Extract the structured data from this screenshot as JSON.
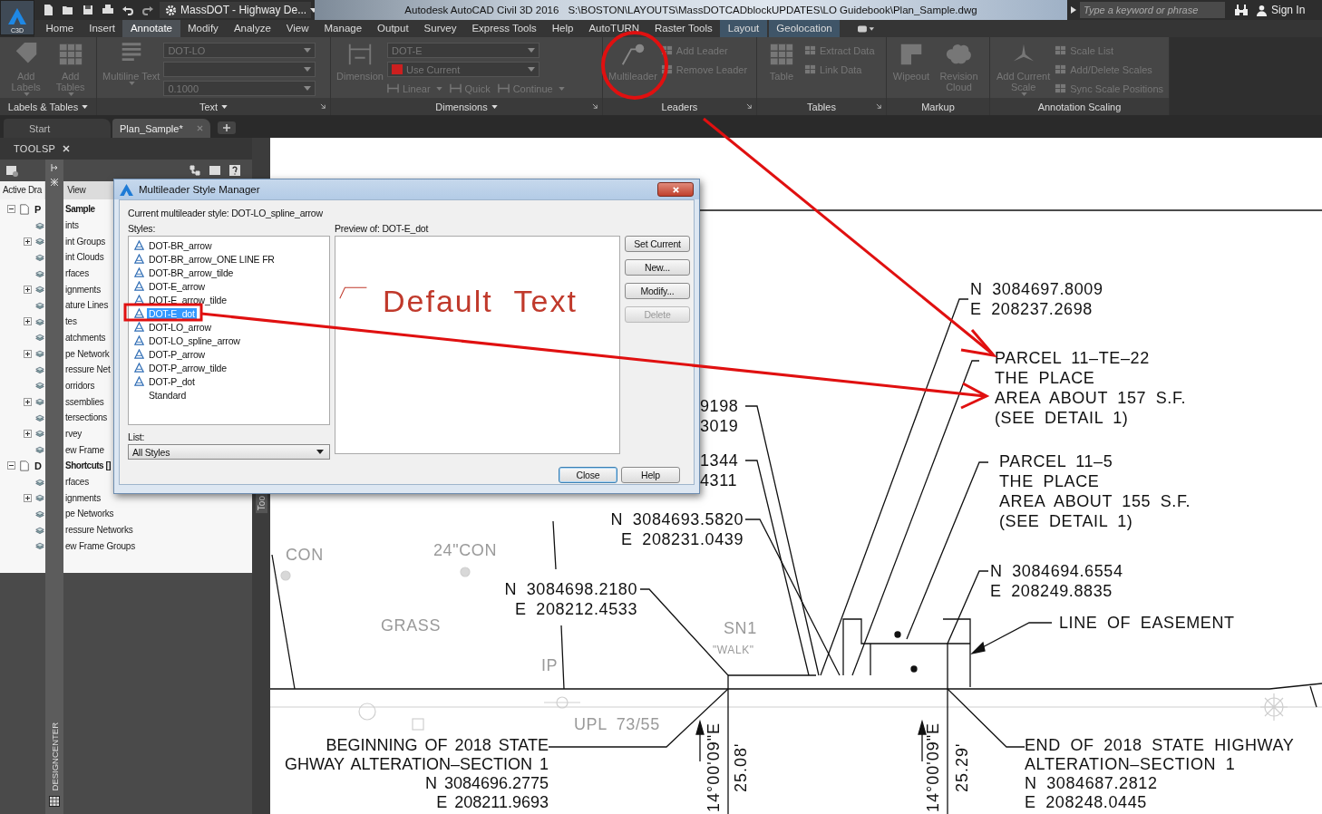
{
  "title_bar": {
    "app_label": "C3D",
    "workspace": "MassDOT - Highway De...",
    "title": "Autodesk AutoCAD Civil 3D 2016",
    "file_path": "S:\\BOSTON\\LAYOUTS\\MassDOTCADblockUPDATES\\LO Guidebook\\Plan_Sample.dwg",
    "search": {
      "placeholder": "Type a keyword or phrase"
    },
    "sign_in": "Sign In"
  },
  "ribbon_tabs": [
    {
      "label": "Home",
      "selected": false,
      "contextual": false
    },
    {
      "label": "Insert",
      "selected": false,
      "contextual": false
    },
    {
      "label": "Annotate",
      "selected": true,
      "contextual": false
    },
    {
      "label": "Modify",
      "selected": false,
      "contextual": false
    },
    {
      "label": "Analyze",
      "selected": false,
      "contextual": false
    },
    {
      "label": "View",
      "selected": false,
      "contextual": false
    },
    {
      "label": "Manage",
      "selected": false,
      "contextual": false
    },
    {
      "label": "Output",
      "selected": false,
      "contextual": false
    },
    {
      "label": "Survey",
      "selected": false,
      "contextual": false
    },
    {
      "label": "Express Tools",
      "selected": false,
      "contextual": false
    },
    {
      "label": "Help",
      "selected": false,
      "contextual": false
    },
    {
      "label": "AutoTURN",
      "selected": false,
      "contextual": false
    },
    {
      "label": "Raster Tools",
      "selected": false,
      "contextual": false
    },
    {
      "label": "Layout",
      "selected": false,
      "contextual": true
    },
    {
      "label": "Geolocation",
      "selected": false,
      "contextual": true
    }
  ],
  "ribbon_panels": [
    {
      "title": "Labels & Tables",
      "menu": true,
      "launcher": false,
      "items": [
        {
          "kind": "large",
          "label": "Add Labels",
          "menu": true,
          "disabled": true
        },
        {
          "kind": "large",
          "label": "Add Tables",
          "menu": true,
          "disabled": true
        }
      ]
    },
    {
      "title": "Text",
      "menu": true,
      "launcher": true,
      "items": [
        {
          "kind": "large",
          "label": "Multiline Text",
          "menu": true,
          "disabled": true
        },
        {
          "kind": "combo",
          "value": "DOT-LO",
          "disabled": true
        },
        {
          "kind": "combo",
          "disabled": true
        },
        {
          "kind": "combo",
          "value": "0.1000",
          "disabled": true
        }
      ]
    },
    {
      "title": "Dimensions",
      "menu": true,
      "launcher": true,
      "items": [
        {
          "kind": "large",
          "label": "Dimension",
          "disabled": true
        },
        {
          "kind": "combo",
          "value": "DOT-E",
          "disabled": true
        },
        {
          "kind": "combo",
          "value": "Use Current",
          "color": "#cc1f1f",
          "disabled": true
        },
        {
          "kind": "row",
          "buttons": [
            {
              "label": "Linear",
              "menu": true,
              "disabled": true
            },
            {
              "label": "Quick",
              "disabled": true
            },
            {
              "label": "Continue",
              "menu": true,
              "disabled": true
            }
          ]
        }
      ]
    },
    {
      "title": "Leaders",
      "menu": false,
      "launcher": true,
      "items": [
        {
          "kind": "large",
          "label": "Multileader",
          "disabled": true
        },
        {
          "kind": "small",
          "label": "Add Leader",
          "disabled": true
        },
        {
          "kind": "small",
          "label": "Remove Leader",
          "disabled": true
        }
      ]
    },
    {
      "title": "Tables",
      "menu": false,
      "launcher": true,
      "items": [
        {
          "kind": "large",
          "label": "Table",
          "disabled": true
        },
        {
          "kind": "small",
          "label": "Extract Data",
          "disabled": true
        },
        {
          "kind": "small",
          "label": "Link Data",
          "disabled": true
        }
      ]
    },
    {
      "title": "Markup",
      "menu": false,
      "launcher": false,
      "items": [
        {
          "kind": "large",
          "label": "Wipeout",
          "disabled": true
        },
        {
          "kind": "large",
          "label": "Revision Cloud",
          "disabled": true
        }
      ]
    },
    {
      "title": "Annotation Scaling",
      "menu": false,
      "launcher": false,
      "items": [
        {
          "kind": "large",
          "label": "Add Current Scale",
          "menu": true,
          "disabled": true
        },
        {
          "kind": "small",
          "label": "Scale List",
          "disabled": true
        },
        {
          "kind": "small",
          "label": "Add/Delete Scales",
          "disabled": true
        },
        {
          "kind": "small",
          "label": "Sync Scale Positions",
          "disabled": true
        }
      ]
    }
  ],
  "file_tabs": [
    {
      "label": "Start",
      "selected": false
    },
    {
      "label": "Plan_Sample*",
      "selected": true
    }
  ],
  "toolspace": {
    "title": "TOOLSP",
    "tabs": [
      {
        "label": "Active Dra",
        "selected": true
      },
      {
        "label": "View",
        "selected": false
      }
    ],
    "tree": [
      {
        "prefix": "P",
        "label": "Sample",
        "expanded": true,
        "children": [
          {
            "label": "ints"
          },
          {
            "label": "int Groups",
            "expanded": false
          },
          {
            "label": "int Clouds"
          },
          {
            "label": "rfaces"
          },
          {
            "label": "ignments",
            "expanded": false
          },
          {
            "label": "ature Lines"
          },
          {
            "label": "tes",
            "expanded": false
          },
          {
            "label": "atchments"
          },
          {
            "label": "pe Network",
            "expanded": false
          },
          {
            "label": "ressure Net"
          },
          {
            "label": "orridors"
          },
          {
            "label": "ssemblies",
            "expanded": false
          },
          {
            "label": "tersections"
          },
          {
            "label": "rvey",
            "expanded": false
          },
          {
            "label": "ew Frame"
          }
        ]
      },
      {
        "prefix": "D",
        "label": "Shortcuts []",
        "expanded": true,
        "children": [
          {
            "label": "rfaces"
          },
          {
            "label": "ignments",
            "expanded": false
          },
          {
            "label": "pe Networks"
          },
          {
            "label": "ressure Networks"
          },
          {
            "label": "ew Frame Groups"
          }
        ]
      }
    ],
    "side_tab": "Too"
  },
  "designcenter": {
    "label": "DESIGNCENTER"
  },
  "dialog": {
    "title": "Multileader Style Manager",
    "current_style": "Current multileader style: DOT-LO_spline_arrow",
    "styles_label": "Styles:",
    "styles": [
      {
        "name": "DOT-BR_arrow",
        "selected": false,
        "annotative": true
      },
      {
        "name": "DOT-BR_arrow_ONE LINE FR",
        "selected": false,
        "annotative": true
      },
      {
        "name": "DOT-BR_arrow_tilde",
        "selected": false,
        "annotative": true
      },
      {
        "name": "DOT-E_arrow",
        "selected": false,
        "annotative": true
      },
      {
        "name": "DOT-E_arrow_tilde",
        "selected": false,
        "annotative": true
      },
      {
        "name": "DOT-E_dot",
        "selected": true,
        "annotative": true
      },
      {
        "name": "DOT-LO_arrow",
        "selected": false,
        "annotative": true
      },
      {
        "name": "DOT-LO_spline_arrow",
        "selected": false,
        "annotative": true
      },
      {
        "name": "DOT-P_arrow",
        "selected": false,
        "annotative": true
      },
      {
        "name": "DOT-P_arrow_tilde",
        "selected": false,
        "annotative": true
      },
      {
        "name": "DOT-P_dot",
        "selected": false,
        "annotative": true
      },
      {
        "name": "Standard",
        "selected": false,
        "annotative": false
      }
    ],
    "list_label": "List:",
    "list_value": "All Styles",
    "preview_label": "Preview of: DOT-E_dot",
    "preview_text": "Default Text",
    "buttons": [
      {
        "label": "Set Current",
        "disabled": false
      },
      {
        "label": "New...",
        "disabled": false
      },
      {
        "label": "Modify...",
        "disabled": false
      },
      {
        "label": "Delete",
        "disabled": true
      }
    ],
    "footer_buttons": [
      {
        "label": "Close",
        "default": true
      },
      {
        "label": "Help",
        "default": false
      }
    ]
  },
  "drawing": {
    "labels": [
      {
        "kind": "note",
        "lines": [
          "N 3084697.8009",
          "E 208237.2698"
        ]
      },
      {
        "kind": "note",
        "lines": [
          "PARCEL 11–TE–22",
          "THE PLACE",
          "AREA ABOUT 157 S.F.",
          "(SEE DETAIL 1)"
        ]
      },
      {
        "kind": "note",
        "lines": [
          "PARCEL 11–5",
          "THE PLACE",
          "AREA ABOUT 155 S.F.",
          "(SEE DETAIL 1)"
        ]
      },
      {
        "kind": "note",
        "lines": [
          "9198",
          "3019"
        ]
      },
      {
        "kind": "note",
        "lines": [
          "1344",
          "4311"
        ]
      },
      {
        "kind": "note",
        "lines": [
          "N 3084693.5820",
          "E 208231.0439"
        ]
      },
      {
        "kind": "note",
        "lines": [
          "N 3084698.2180",
          "E 208212.4533"
        ]
      },
      {
        "kind": "note",
        "lines": [
          "N 3084694.6554",
          "E 208249.8835"
        ]
      },
      {
        "kind": "note",
        "lines": [
          "LINE OF EASEMENT"
        ]
      },
      {
        "kind": "note",
        "lines": [
          "BEGINNING OF 2018 STATE",
          "GHWAY ALTERATION–SECTION 1",
          "N 3084696.2775",
          "E 208211.9693"
        ]
      },
      {
        "kind": "note",
        "lines": [
          "END OF 2018 STATE HIGHWAY",
          "ALTERATION–SECTION 1",
          "N 3084687.2812",
          "E 208248.0445"
        ]
      },
      {
        "kind": "faint",
        "lines": [
          "CON"
        ]
      },
      {
        "kind": "faint",
        "lines": [
          "24\"CON"
        ]
      },
      {
        "kind": "faint",
        "lines": [
          "GRASS"
        ]
      },
      {
        "kind": "faint",
        "lines": [
          "SN1"
        ]
      },
      {
        "kind": "faint",
        "lines": [
          "\"WALK\""
        ]
      },
      {
        "kind": "faint",
        "lines": [
          "IP"
        ]
      },
      {
        "kind": "faint",
        "lines": [
          "UPL 73/55"
        ]
      }
    ],
    "bearings": [
      {
        "bearing": "14°00'09\"E",
        "distance": "25.08'"
      },
      {
        "bearing": "14°00'09\"E",
        "distance": "25.29'"
      }
    ]
  }
}
